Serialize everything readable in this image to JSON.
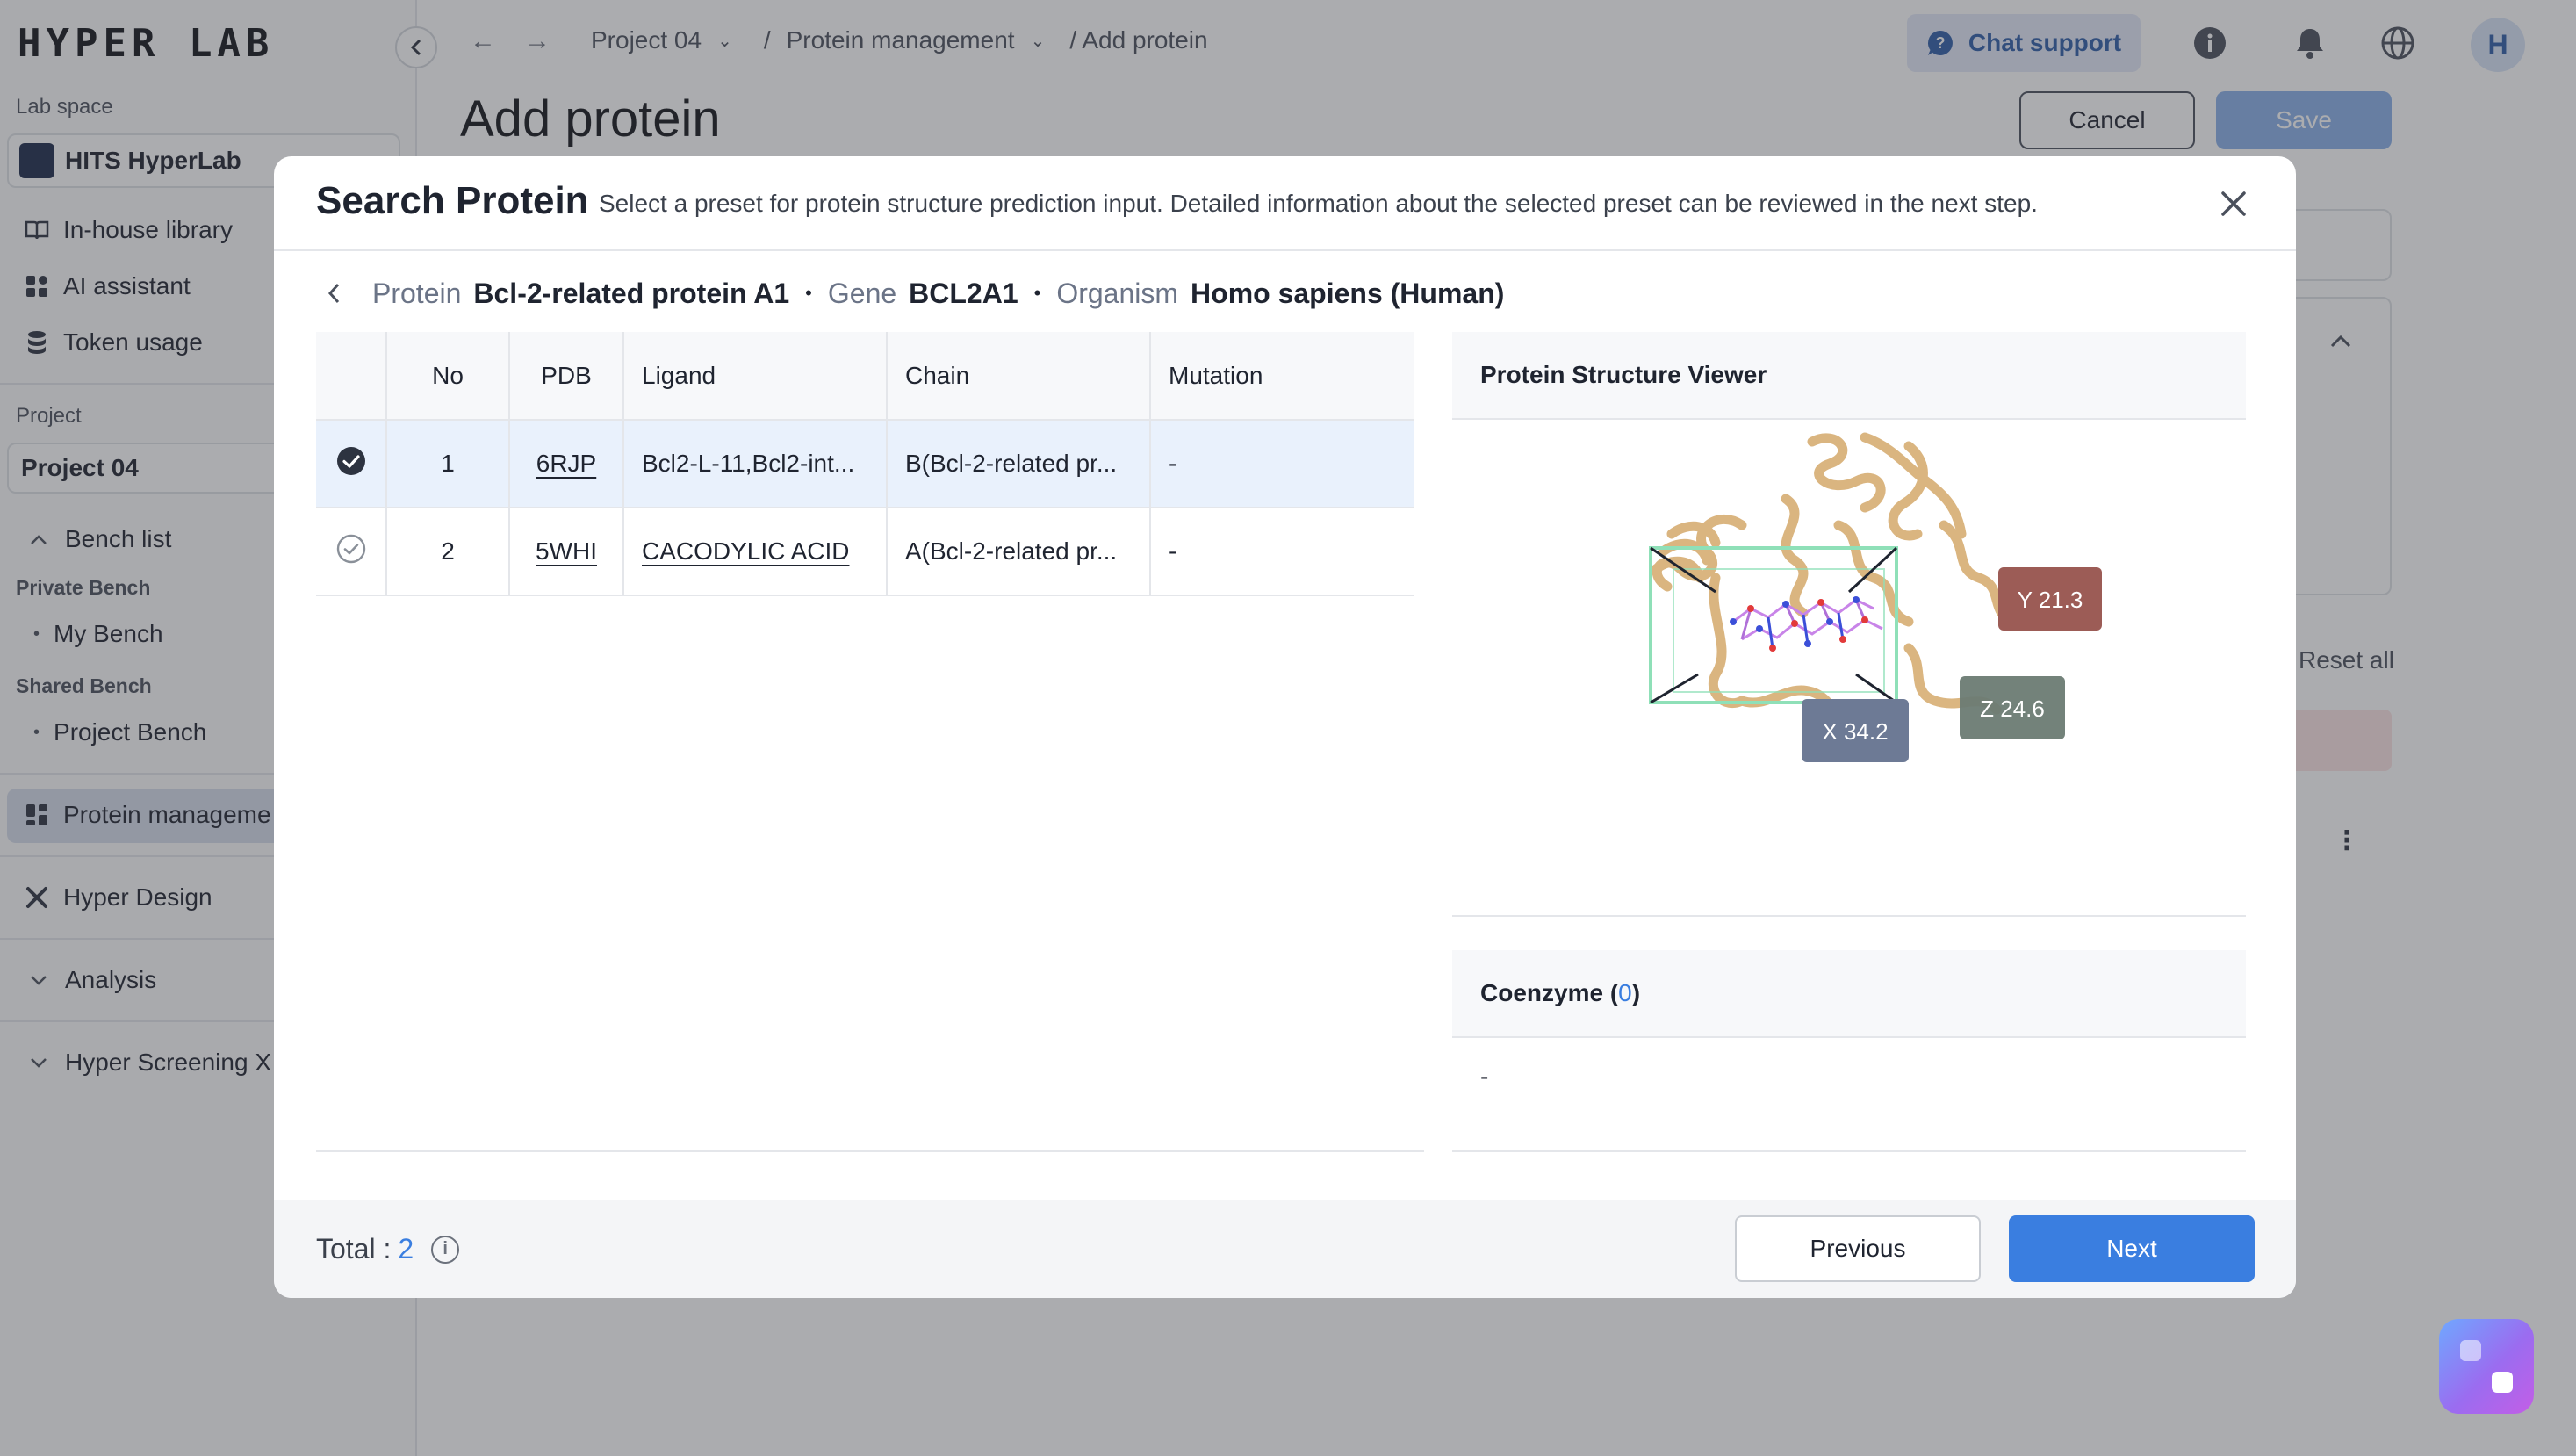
{
  "app": {
    "logo": "HYPER LAB",
    "lab_space_label": "Lab space",
    "lab_space_name": "HITS HyperLab",
    "nav_top": [
      "In-house library",
      "AI assistant",
      "Token usage"
    ],
    "project_label": "Project",
    "project_name": "Project 04",
    "bench_list": "Bench list",
    "private_bench": "Private Bench",
    "my_bench": "My Bench",
    "shared_bench": "Shared Bench",
    "project_bench": "Project Bench",
    "protein_management": "Protein manageme",
    "hyper_design": "Hyper Design",
    "analysis": "Analysis",
    "hyper_screening": "Hyper Screening X"
  },
  "topbar": {
    "crumb_project": "Project 04",
    "crumb_sep": "/",
    "crumb_protein": "Protein management",
    "crumb_current": "/ Add protein",
    "chat_support": "Chat support",
    "avatar": "H"
  },
  "page": {
    "title": "Add protein",
    "cancel": "Cancel",
    "save": "Save",
    "reset_all": "Reset all"
  },
  "modal": {
    "title": "Search Protein",
    "description": "Select a preset for protein structure prediction input. Detailed information about the selected preset can be reviewed in the next step.",
    "protein_key": "Protein",
    "protein_value": "Bcl-2-related protein A1",
    "gene_key": "Gene",
    "gene_value": "BCL2A1",
    "organism_key": "Organism",
    "organism_value": "Homo sapiens (Human)",
    "bullet": "•",
    "table": {
      "headers": [
        "No",
        "PDB",
        "Ligand",
        "Chain",
        "Mutation"
      ],
      "rows": [
        {
          "no": "1",
          "pdb": "6RJP",
          "ligand": "Bcl2-L-11,Bcl2-int...",
          "chain": "B(Bcl-2-related pr...",
          "mutation": "-",
          "selected": true
        },
        {
          "no": "2",
          "pdb": "5WHI",
          "ligand": "CACODYLIC ACID",
          "chain": "A(Bcl-2-related pr...",
          "mutation": "-",
          "selected": false
        }
      ]
    },
    "viewer": {
      "title": "Protein Structure Viewer",
      "x_label": "X 34.2",
      "y_label": "Y 21.3",
      "z_label": "Z 24.6"
    },
    "coenzyme": {
      "label": "Coenzyme (",
      "count": "0",
      "close": ")",
      "value": "-"
    },
    "footer": {
      "total_label": "Total :",
      "total_value": "2",
      "info_icon": "i",
      "previous": "Previous",
      "next": "Next"
    }
  },
  "colors": {
    "primary": "#3a7ee0",
    "selected_row": "#e9f1fc",
    "overlay": "rgba(55,58,64,0.42)",
    "ribbon": "#d9b27a",
    "box_line": "#8fe0b8",
    "x_badge": "#6d7a95",
    "y_badge": "#9c5c56",
    "z_badge": "#6b7b73"
  }
}
